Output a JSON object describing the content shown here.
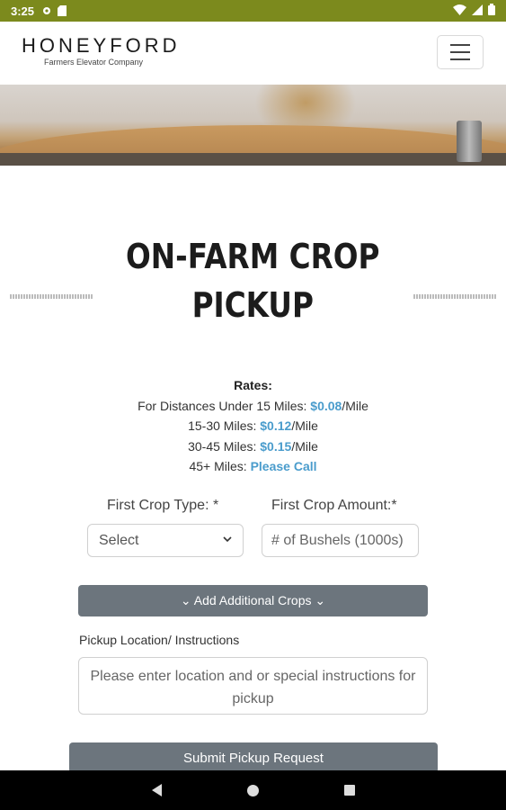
{
  "status_bar": {
    "time": "3:25",
    "left_icons": [
      "gear-icon",
      "sd-card-icon"
    ],
    "right_icons": [
      "wifi-icon",
      "signal-icon",
      "battery-icon"
    ],
    "color": "#7c8a1d"
  },
  "header": {
    "logo_text": "HONEYFORD",
    "logo_subtext": "Farmers Elevator Company",
    "menu_icon": "hamburger-menu-icon"
  },
  "page": {
    "title_line1": "ON-FARM CROP",
    "title_line2": "PICKUP"
  },
  "rates": {
    "heading": "Rates:",
    "rows": [
      {
        "label": "For Distances Under 15 Miles: ",
        "value": "$0.08",
        "suffix": "/Mile"
      },
      {
        "label": "15-30 Miles: ",
        "value": "$0.12",
        "suffix": "/Mile"
      },
      {
        "label": "30-45 Miles: ",
        "value": "$0.15",
        "suffix": "/Mile"
      },
      {
        "label": "45+ Miles: ",
        "value": "Please Call",
        "suffix": ""
      }
    ],
    "accent_color": "#4a9ccc"
  },
  "form": {
    "crop_type_label": "First Crop Type: *",
    "crop_type_value": "Select",
    "crop_amount_label": "First Crop Amount:*",
    "crop_amount_placeholder": "# of Bushels (1000s)",
    "add_crops_label": "⌄ Add Additional Crops ⌄",
    "pickup_label": "Pickup Location/ Instructions",
    "pickup_placeholder": "Please enter location and or special instructions for pickup",
    "submit_label": "Submit Pickup Request",
    "button_color": "#6c757d"
  },
  "nav_bar": {
    "icons": [
      "back-icon",
      "home-icon",
      "recents-icon"
    ]
  }
}
